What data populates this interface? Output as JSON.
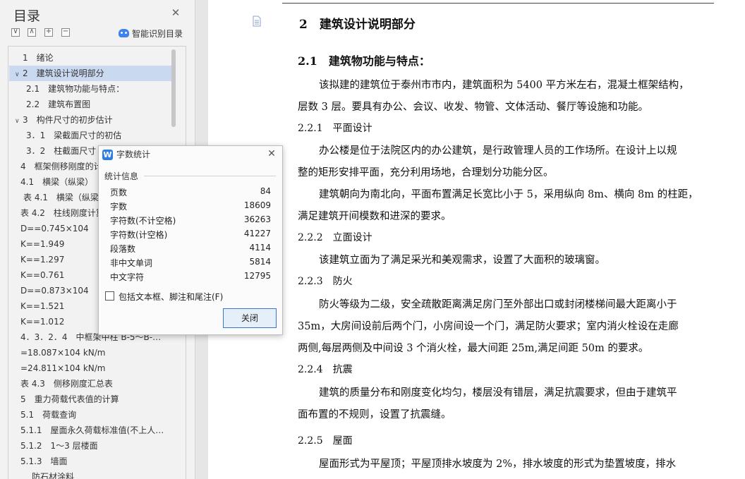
{
  "nav": {
    "title": "目录",
    "smart_label": "智能识别目录",
    "toolbar_icons": [
      "collapse-all-icon",
      "expand-all-icon",
      "add-level-icon",
      "remove-level-icon"
    ],
    "toc": [
      {
        "label": "1　绪论",
        "indent": 0,
        "arrow": ""
      },
      {
        "label": "2　建筑设计说明部分",
        "indent": 0,
        "arrow": "∨",
        "selected": true
      },
      {
        "label": "2.1　建筑物功能与特点：",
        "indent": 2
      },
      {
        "label": "2.2　建筑布置图",
        "indent": 2
      },
      {
        "label": "3　构件尺寸的初步估计",
        "indent": 0,
        "arrow": "∨"
      },
      {
        "label": "3．1　梁截面尺寸的初估",
        "indent": 2
      },
      {
        "label": "3．2　柱截面尺寸",
        "indent": 2
      },
      {
        "label": "4　框架侧移刚度的计算",
        "indent": 1
      },
      {
        "label": "4.1　横梁（纵梁）",
        "indent": 1
      },
      {
        "label": "表 4.1　横梁（纵梁）",
        "indent": 1.5
      },
      {
        "label": "表 4.2　柱线刚度计算",
        "indent": 1
      },
      {
        "label": "D==0.745×104",
        "indent": 1
      },
      {
        "label": "K==1.949",
        "indent": 1
      },
      {
        "label": "K==1.297",
        "indent": 1
      },
      {
        "label": "K==0.761",
        "indent": 1
      },
      {
        "label": "D==0.873×104",
        "indent": 1
      },
      {
        "label": "K==1.521",
        "indent": 1
      },
      {
        "label": "K==1.012",
        "indent": 1
      },
      {
        "label": "4．3．2．4　中框架中柱 B-5～B-…",
        "indent": 1
      },
      {
        "label": "=18.087×104 kN/m",
        "indent": 1
      },
      {
        "label": "=24.811×104 kN/m",
        "indent": 1
      },
      {
        "label": "表 4.3　侧移刚度汇总表",
        "indent": 1
      },
      {
        "label": "5　重力荷载代表值的计算",
        "indent": 1
      },
      {
        "label": "5.1　荷载查询",
        "indent": 1
      },
      {
        "label": "5.1.1　屋面永久荷载标准值(不上人…",
        "indent": 1
      },
      {
        "label": "5.1.2　1～3 层楼面",
        "indent": 1
      },
      {
        "label": "5.1.3　墙面",
        "indent": 1
      },
      {
        "label": "防石材涂料",
        "indent": 3
      }
    ]
  },
  "document": {
    "heading": "2　建筑设计说明部分",
    "sections": [
      {
        "kind": "h3",
        "text": "2.1　建筑物功能与特点："
      },
      {
        "kind": "p",
        "text": "该拟建的建筑位于泰州市市内，建筑面积为 5400 平方米左右，混凝土框架结构，"
      },
      {
        "kind": "p0",
        "text": "层数 3 层。要具有办公、会议、收发、物管、文体活动、餐厅等设施和功能。"
      },
      {
        "kind": "h4",
        "text": "2.2.1　平面设计"
      },
      {
        "kind": "p",
        "text": "办公楼是位于法院区内的办公建筑，是行政管理人员的工作场所。在设计上以规"
      },
      {
        "kind": "p0",
        "text": "整的矩形安排平面，充分利用场地，合理划分功能分区。"
      },
      {
        "kind": "p",
        "text": "建筑朝向为南北向，平面布置满足长宽比小于 5，采用纵向 8m、横向 8m 的柱距，"
      },
      {
        "kind": "p0",
        "text": "满足建筑开间模数和进深的要求。"
      },
      {
        "kind": "h4",
        "text": "2.2.2　立面设计"
      },
      {
        "kind": "p",
        "text": "该建筑立面为了满足采光和美观需求，设置了大面积的玻璃窗。"
      },
      {
        "kind": "h4",
        "text": "2.2.3　防火"
      },
      {
        "kind": "p",
        "text": "防火等级为二级，安全疏散距离满足房门至外部出口或封闭楼梯间最大距离小于"
      },
      {
        "kind": "p0",
        "text": "35m，大房间设前后两个门，小房间设一个门，满足防火要求；室内消火栓设在走廊"
      },
      {
        "kind": "p0",
        "text": "两侧,每层两侧及中间设 3 个消火栓，最大间距 25m,满足间距 50m 的要求。"
      },
      {
        "kind": "h4",
        "text": "2.2.4　抗震"
      },
      {
        "kind": "p",
        "text": "建筑的质量分布和刚度变化均匀，楼层没有错层，满足抗震要求，但由于建筑平"
      },
      {
        "kind": "p0",
        "text": "面布置的不规则，设置了抗震缝。"
      },
      {
        "kind": "h4",
        "text": "2.2.5　屋面"
      },
      {
        "kind": "p",
        "text": "屋面形式为平屋顶；平屋顶排水坡度为 2%，排水坡度的形式为垫置坡度，排水"
      }
    ]
  },
  "dialog": {
    "title": "字数统计",
    "group_label": "统计信息",
    "stats": [
      {
        "label": "页数",
        "value": "84"
      },
      {
        "label": "字数",
        "value": "18609"
      },
      {
        "label": "字符数(不计空格)",
        "value": "36263"
      },
      {
        "label": "字符数(计空格)",
        "value": "41227"
      },
      {
        "label": "段落数",
        "value": "4114"
      },
      {
        "label": "非中文单词",
        "value": "5814"
      },
      {
        "label": "中文字符",
        "value": "12795"
      }
    ],
    "checkbox_label": "包括文本框、脚注和尾注(F)",
    "checkbox_checked": false,
    "close_button": "关闭"
  },
  "colors": {
    "selection": "#c9d9f0",
    "accent": "#2f7de1",
    "button_border": "#3c74c8"
  }
}
